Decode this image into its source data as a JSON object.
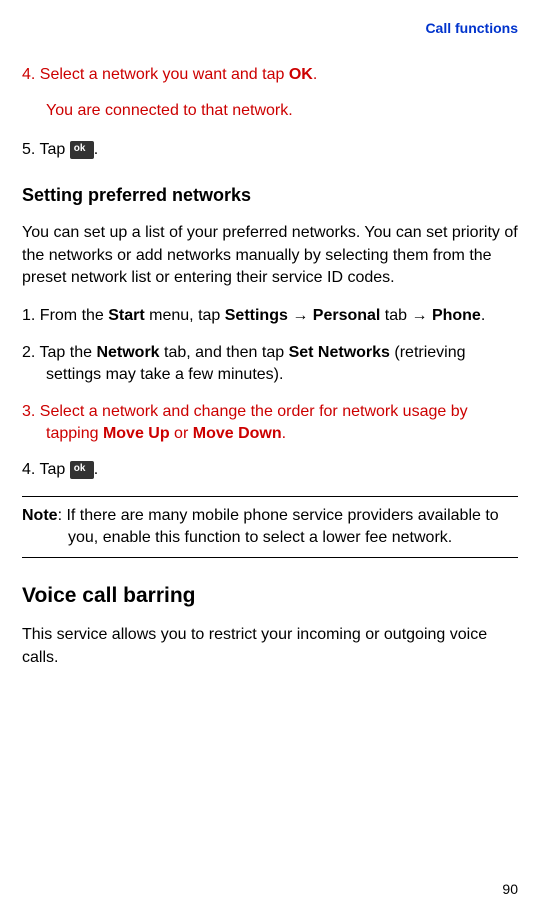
{
  "header": {
    "title": "Call functions"
  },
  "step4_prefix": "4. Select a network you want and tap ",
  "step4_ok": "OK",
  "step4_suffix": ".",
  "step4_sub": "You are connected to that network.",
  "step5_prefix": "5. Tap ",
  "step5_suffix": ".",
  "section1_heading": "Setting preferred networks",
  "section1_para": "You can set up a list of your preferred networks. You can set priority of the networks or add networks manually by selecting them from the preset network list or entering their service ID codes.",
  "s1_step1_a": "1. From the ",
  "s1_step1_start": "Start",
  "s1_step1_b": " menu, tap ",
  "s1_step1_settings": "Settings",
  "s1_step1_c": " → ",
  "s1_step1_personal": "Personal",
  "s1_step1_d": " tab → ",
  "s1_step1_phone": "Phone",
  "s1_step1_e": ".",
  "s1_step2_a": "2. Tap the ",
  "s1_step2_network": "Network",
  "s1_step2_b": " tab, and then tap ",
  "s1_step2_setnet": "Set Networks",
  "s1_step2_c": " (retrieving settings may take a few minutes).",
  "s1_step3_a": "3. Select a network and change the order for network usage by tapping ",
  "s1_step3_moveup": "Move Up",
  "s1_step3_b": " or ",
  "s1_step3_movedown": "Move Down",
  "s1_step3_c": ".",
  "s1_step4_a": "4. Tap ",
  "s1_step4_b": ".",
  "note_label": "Note",
  "note_text": ": If there are many mobile phone service providers available to you, enable this function to select a lower fee network.",
  "section2_heading": "Voice call barring",
  "section2_para": "This service allows you to restrict your incoming or outgoing voice calls.",
  "ok_icon_text": "ok",
  "page_number": "90"
}
